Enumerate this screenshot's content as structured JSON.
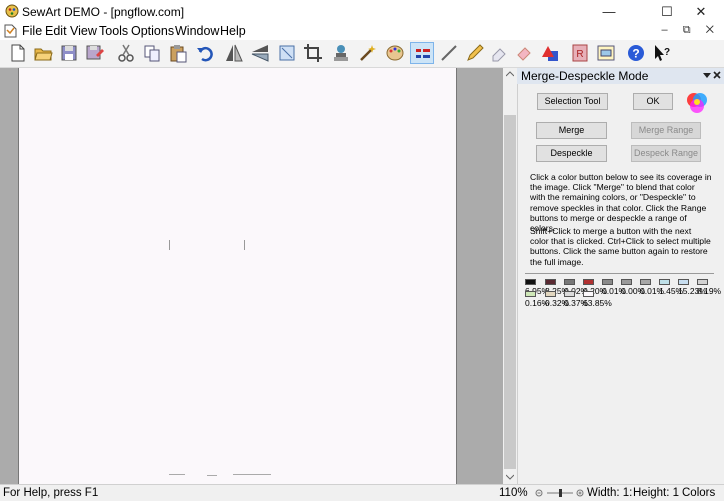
{
  "window": {
    "title": "SewArt DEMO - [pngflow.com]",
    "minimize_glyph": "—",
    "maximize_glyph": "☐",
    "close_glyph": "✕"
  },
  "menu": {
    "items": [
      "File",
      "Edit",
      "View",
      "Tools",
      "Options",
      "Window",
      "Help"
    ],
    "mdi_controls": "– ⧉ ✕"
  },
  "toolbar": {
    "icons": [
      "new-file-icon",
      "open-folder-icon",
      "save-icon",
      "save-as-icon",
      "cut-icon",
      "copy-icon",
      "paste-icon",
      "undo-icon",
      "flip-vertical-icon",
      "flip-horizontal-icon",
      "resize-icon",
      "crop-icon",
      "stamp-icon",
      "magic-wand-icon",
      "palette-icon",
      "merge-mode-icon",
      "line-tool-icon",
      "pencil-icon",
      "eraser-icon",
      "color-fill-icon",
      "shapes-icon",
      "sew-icon",
      "export-icon",
      "help-icon",
      "context-help-icon"
    ]
  },
  "panel": {
    "title": "Merge-Despeckle Mode",
    "selection_tool": "Selection Tool",
    "ok": "OK",
    "merge": "Merge",
    "merge_range": "Merge Range",
    "despeckle": "Despeckle",
    "despeck_range": "Despeck Range",
    "instructions_1": "Click a color button below to see its coverage in the image. Click \"Merge\" to blend that color with the remaining colors, or \"Despeckle\" to remove speckles in that color. Click the Range buttons to merge or despeckle a range of colors.",
    "instructions_2": "Shift+Click to merge a button with the next color that is clicked. Ctrl+Click to select multiple buttons. Click the same button again to restore the full image.",
    "colors_row1": [
      {
        "color": "#111111",
        "pct": "6.95%"
      },
      {
        "color": "#5a2a32",
        "pct": "8.25%"
      },
      {
        "color": "#777777",
        "pct": "0.02%"
      },
      {
        "color": "#b03030",
        "pct": "0.20%"
      },
      {
        "color": "#8a8a8a",
        "pct": "0.01%"
      },
      {
        "color": "#9a9a9a",
        "pct": "0.00%"
      },
      {
        "color": "#a8a8a8",
        "pct": "0.01%"
      },
      {
        "color": "#bfe0e8",
        "pct": "1.45%"
      },
      {
        "color": "#c8def0",
        "pct": "15.23%"
      },
      {
        "color": "#d2d2d2",
        "pct": "8.19%"
      }
    ],
    "colors_row2": [
      {
        "color": "#cfe8b8",
        "pct": "0.16%"
      },
      {
        "color": "#e2d7c0",
        "pct": "0.32%"
      },
      {
        "color": "#dcdcdc",
        "pct": "0.37%"
      },
      {
        "color": "#fbf8fb",
        "pct": "63.85%"
      }
    ]
  },
  "status": {
    "help": "For Help, press F1",
    "zoom": "110%",
    "width": "Width: 1:",
    "height": "Height: 1",
    "colors": "Colors"
  }
}
